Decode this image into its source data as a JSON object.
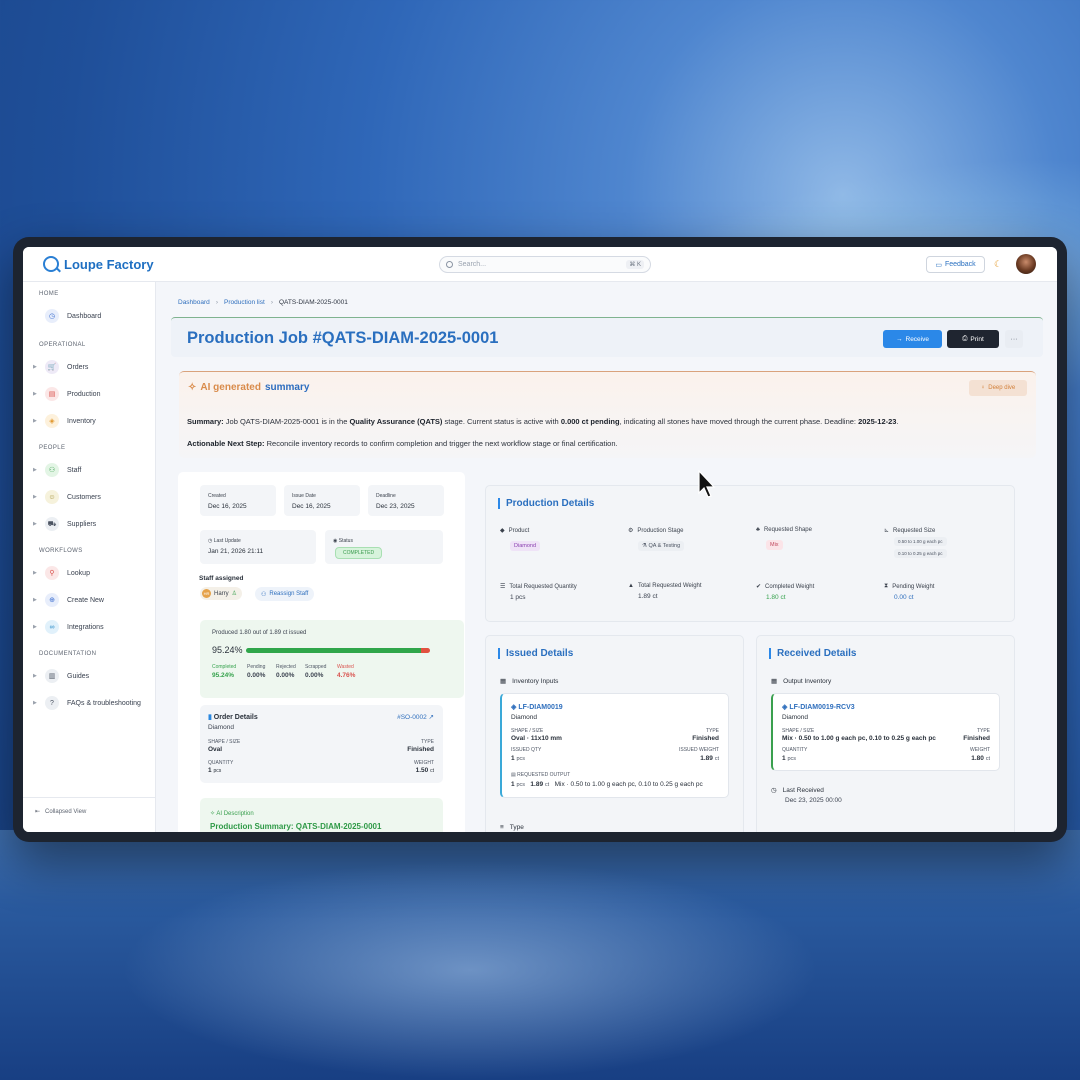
{
  "app": {
    "name": "Loupe Factory"
  },
  "search": {
    "placeholder": "Search...",
    "shortcut": "⌘ K"
  },
  "topbar": {
    "feedback_label": "Feedback"
  },
  "sidebar": {
    "sections": [
      {
        "label": "HOME"
      },
      {
        "label": "OPERATIONAL"
      },
      {
        "label": "PEOPLE"
      },
      {
        "label": "WORKFLOWS"
      },
      {
        "label": "DOCUMENTATION"
      }
    ],
    "items": [
      {
        "label": "Dashboard"
      },
      {
        "label": "Orders"
      },
      {
        "label": "Production"
      },
      {
        "label": "Inventory"
      },
      {
        "label": "Staff"
      },
      {
        "label": "Customers"
      },
      {
        "label": "Suppliers"
      },
      {
        "label": "Lookup"
      },
      {
        "label": "Create New"
      },
      {
        "label": "Integrations"
      },
      {
        "label": "Guides"
      },
      {
        "label": "FAQs & troubleshooting"
      }
    ],
    "collapse_label": "Collapsed View"
  },
  "breadcrumb": {
    "home": "Dashboard",
    "list": "Production list",
    "current": "QATS-DIAM-2025-0001"
  },
  "page": {
    "title": "Production Job #QATS-DIAM-2025-0001",
    "receive_label": "Receive",
    "print_label": "Print",
    "more_label": "···"
  },
  "ai_summary": {
    "title_prefix": "AI generated",
    "title_word": "summary",
    "deep_dive_label": "Deep dive",
    "summary_label": "Summary:",
    "summary_a": "Job QATS-DIAM-2025-0001 is in the",
    "summary_stage": "Quality Assurance (QATS)",
    "summary_b": "stage. Current status is active with",
    "summary_pending": "0.000 ct pending",
    "summary_c": ", indicating all stones have moved through the current phase. Deadline:",
    "summary_deadline": "2025-12-23",
    "summary_d": ".",
    "next_label": "Actionable Next Step:",
    "next_text": "Reconcile inventory records to confirm completion and trigger the next workflow stage or final certification."
  },
  "job_meta": {
    "created_label": "Created",
    "created": "Dec 16, 2025",
    "issue_label": "Issue Date",
    "issue": "Dec 16, 2025",
    "deadline_label": "Deadline",
    "deadline": "Dec 23, 2025",
    "update_label": "Last Update",
    "update": "Jan 21, 2026 21:11",
    "status_label": "Status",
    "status": "COMPLETED"
  },
  "staff": {
    "label": "Staff assigned",
    "member_initials": "HR",
    "member": "Harry",
    "reassign_label": "Reassign Staff"
  },
  "progress": {
    "text": "Produced 1.80 out of 1.89 ct issued",
    "percent_label": "95.24%",
    "completed_fraction": 0.9524,
    "wasted_fraction": 0.0476,
    "stats": [
      {
        "label": "Completed",
        "value": "95.24%"
      },
      {
        "label": "Pending",
        "value": "0.00%"
      },
      {
        "label": "Rejected",
        "value": "0.00%"
      },
      {
        "label": "Scrapped",
        "value": "0.00%"
      },
      {
        "label": "Wasted",
        "value": "4.76%"
      }
    ]
  },
  "order": {
    "title": "Order Details",
    "link": "#SO-0002",
    "type_name": "Diamond",
    "shape_label": "SHAPE / SIZE",
    "shape": "Oval",
    "type_label": "TYPE",
    "type": "Finished",
    "qty_label": "QUANTITY",
    "qty": "1",
    "qty_unit": "pcs",
    "weight_label": "WEIGHT",
    "weight": "1.50",
    "weight_unit": "ct"
  },
  "ai_description": {
    "label": "AI Description",
    "title": "Production Summary: QATS-DIAM-2025-0001"
  },
  "production_details": {
    "title": "Production Details",
    "product_label": "Product",
    "product": "Diamond",
    "stage_label": "Production Stage",
    "stage": "QA & Testing",
    "shape_label": "Requested Shape",
    "shape": "Mix",
    "size_label": "Requested Size",
    "size_1": "0.50 to 1.00 g each pc",
    "size_2": "0.10 to 0.25 g each pc",
    "total_qty_label": "Total Requested Quantity",
    "total_qty": "1 pcs",
    "total_weight_label": "Total Requested Weight",
    "total_weight": "1.89 ct",
    "completed_weight_label": "Completed Weight",
    "completed_weight": "1.80 ct",
    "pending_weight_label": "Pending Weight",
    "pending_weight": "0.00 ct"
  },
  "issued": {
    "title": "Issued Details",
    "sub": "Inventory Inputs",
    "id": "LF-DIAM0019",
    "type_name": "Diamond",
    "shape_label": "SHAPE / SIZE",
    "shape": "Oval · 11x10 mm",
    "type_label": "TYPE",
    "type": "Finished",
    "qty_label": "ISSUED QTY",
    "qty": "1",
    "qty_unit": "pcs",
    "weight_label": "ISSUED WEIGHT",
    "weight": "1.89",
    "weight_unit": "ct",
    "req_label": "REQUESTED OUTPUT",
    "req_qty": "1",
    "req_qty_unit": "pcs",
    "req_weight": "1.89",
    "req_weight_unit": "ct",
    "req_desc": "Mix · 0.50 to 1.00 g each pc, 0.10 to 0.25 g each pc",
    "type_section": "Type"
  },
  "received": {
    "title": "Received Details",
    "sub": "Output Inventory",
    "id": "LF-DIAM0019-RCV3",
    "type_name": "Diamond",
    "shape_label": "SHAPE / SIZE",
    "shape": "Mix · 0.50 to 1.00 g each pc, 0.10 to 0.25 g each pc",
    "type_label": "TYPE",
    "type": "Finished",
    "qty_label": "QUANTITY",
    "qty": "1",
    "qty_unit": "pcs",
    "weight_label": "WEIGHT",
    "weight": "1.80",
    "weight_unit": "ct",
    "last_label": "Last Received",
    "last": "Dec 23, 2025 00:00"
  }
}
